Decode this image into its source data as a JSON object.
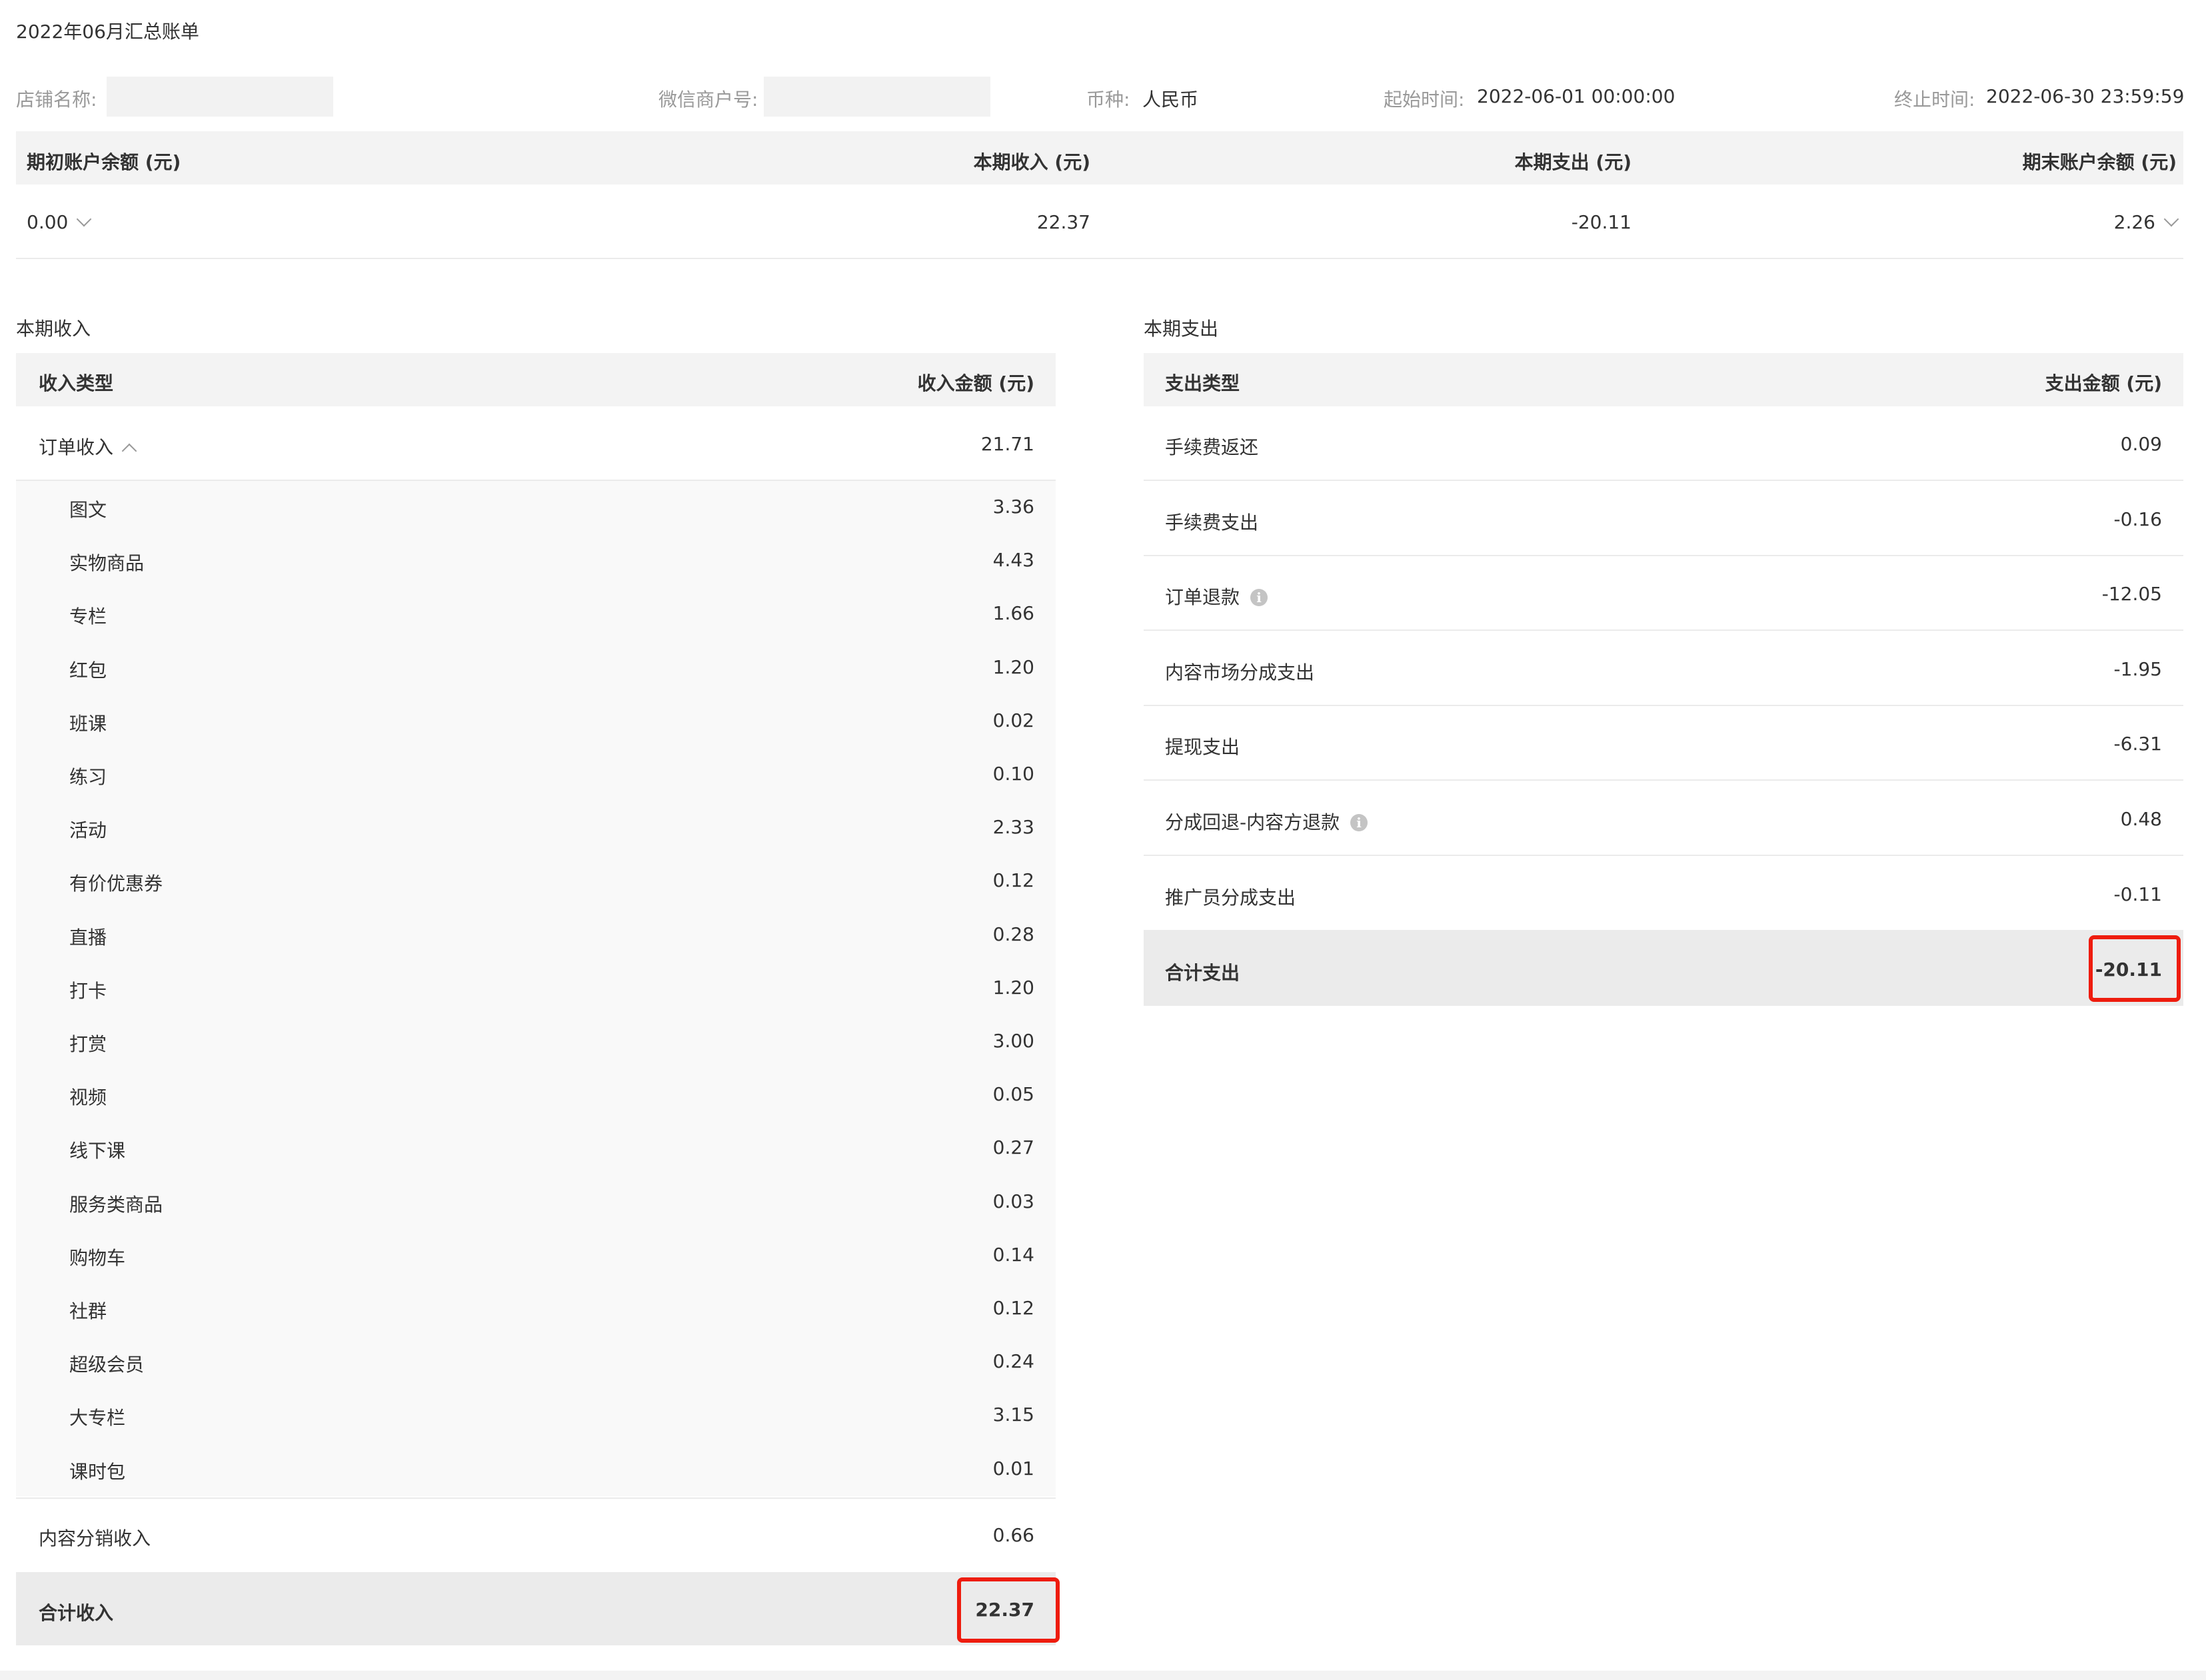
{
  "page_title": "2022年06月汇总账单",
  "filters": {
    "store_name_label": "店铺名称:",
    "merchant_id_label": "微信商户号:",
    "currency_label": "币种:",
    "currency_value": "人民币",
    "start_label": "起始时间:",
    "start_value": "2022-06-01 00:00:00",
    "end_label": "终止时间:",
    "end_value": "2022-06-30 23:59:59"
  },
  "summary": {
    "headers": [
      "期初账户余额 (元)",
      "本期收入 (元)",
      "本期支出 (元)",
      "期末账户余额 (元)"
    ],
    "opening_balance": "0.00",
    "income": "22.37",
    "expense": "-20.11",
    "closing_balance": "2.26"
  },
  "income": {
    "section_title": "本期收入",
    "col_type": "收入类型",
    "col_amount": "收入金额 (元)",
    "order_income_label": "订单收入",
    "order_income_value": "21.71",
    "sub_items": [
      {
        "label": "图文",
        "value": "3.36"
      },
      {
        "label": "实物商品",
        "value": "4.43"
      },
      {
        "label": "专栏",
        "value": "1.66"
      },
      {
        "label": "红包",
        "value": "1.20"
      },
      {
        "label": "班课",
        "value": "0.02"
      },
      {
        "label": "练习",
        "value": "0.10"
      },
      {
        "label": "活动",
        "value": "2.33"
      },
      {
        "label": "有价优惠券",
        "value": "0.12"
      },
      {
        "label": "直播",
        "value": "0.28"
      },
      {
        "label": "打卡",
        "value": "1.20"
      },
      {
        "label": "打赏",
        "value": "3.00"
      },
      {
        "label": "视频",
        "value": "0.05"
      },
      {
        "label": "线下课",
        "value": "0.27"
      },
      {
        "label": "服务类商品",
        "value": "0.03"
      },
      {
        "label": "购物车",
        "value": "0.14"
      },
      {
        "label": "社群",
        "value": "0.12"
      },
      {
        "label": "超级会员",
        "value": "0.24"
      },
      {
        "label": "大专栏",
        "value": "3.15"
      },
      {
        "label": "课时包",
        "value": "0.01"
      }
    ],
    "distribution_label": "内容分销收入",
    "distribution_value": "0.66",
    "total_label": "合计收入",
    "total_value": "22.37"
  },
  "expense": {
    "section_title": "本期支出",
    "col_type": "支出类型",
    "col_amount": "支出金额 (元)",
    "rows": [
      {
        "label": "手续费返还",
        "value": "0.09",
        "info": false
      },
      {
        "label": "手续费支出",
        "value": "-0.16",
        "info": false
      },
      {
        "label": "订单退款",
        "value": "-12.05",
        "info": true
      },
      {
        "label": "内容市场分成支出",
        "value": "-1.95",
        "info": false
      },
      {
        "label": "提现支出",
        "value": "-6.31",
        "info": false
      },
      {
        "label": "分成回退-内容方退款",
        "value": "0.48",
        "info": true
      },
      {
        "label": "推广员分成支出",
        "value": "-0.11",
        "info": false
      }
    ],
    "total_label": "合计支出",
    "total_value": "-20.11"
  },
  "icons": {
    "info": "info-icon",
    "expand": "chevron-down-icon",
    "collapse": "chevron-up-icon"
  },
  "colors": {
    "highlight": "#ee1c0e",
    "header_bg": "#f3f3f3",
    "total_bg": "#ebebeb"
  }
}
